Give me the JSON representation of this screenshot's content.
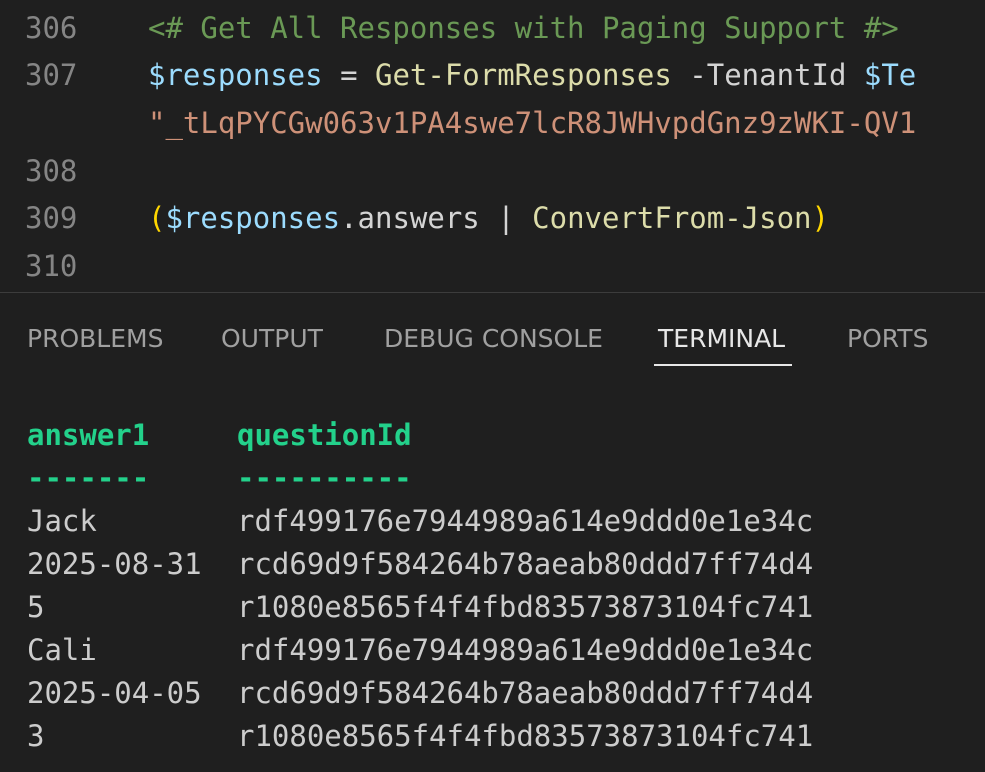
{
  "editor": {
    "lines": [
      {
        "num": "306",
        "tokens": [
          {
            "t": "<# Get All Responses with Paging Support #>",
            "c": "comment"
          }
        ]
      },
      {
        "num": "307",
        "tokens": [
          {
            "t": "$responses",
            "c": "var"
          },
          {
            "t": " = ",
            "c": "op"
          },
          {
            "t": "Get-FormResponses",
            "c": "fn"
          },
          {
            "t": " -TenantId ",
            "c": "param"
          },
          {
            "t": "$Te",
            "c": "var"
          }
        ]
      },
      {
        "num": "",
        "tokens": [
          {
            "t": "\"_tLqPYCGw063v1PA4swe7lcR8JWHvpdGnz9zWKI-QV1",
            "c": "str"
          }
        ]
      },
      {
        "num": "308",
        "tokens": []
      },
      {
        "num": "309",
        "tokens": [
          {
            "t": "(",
            "c": "paren"
          },
          {
            "t": "$responses",
            "c": "var"
          },
          {
            "t": ".answers",
            "c": "plain"
          },
          {
            "t": " | ",
            "c": "op"
          },
          {
            "t": "ConvertFrom-Json",
            "c": "fn"
          },
          {
            "t": ")",
            "c": "paren"
          }
        ]
      },
      {
        "num": "310",
        "tokens": []
      }
    ]
  },
  "panel": {
    "tabs": [
      "PROBLEMS",
      "OUTPUT",
      "DEBUG CONSOLE",
      "TERMINAL",
      "PORTS"
    ],
    "active_tab": "TERMINAL"
  },
  "terminal": {
    "headers": [
      "answer1",
      "questionId"
    ],
    "separators": [
      "-------",
      "----------"
    ],
    "rows": [
      [
        "Jack",
        "rdf499176e7944989a614e9ddd0e1e34c"
      ],
      [
        "2025-08-31",
        "rcd69d9f584264b78aeab80ddd7ff74d4"
      ],
      [
        "5",
        "r1080e8565f4f4fbd83573873104fc741"
      ],
      [
        "Cali",
        "rdf499176e7944989a614e9ddd0e1e34c"
      ],
      [
        "2025-04-05",
        "rcd69d9f584264b78aeab80ddd7ff74d4"
      ],
      [
        "3",
        "r1080e8565f4f4fbd83573873104fc741"
      ]
    ]
  },
  "colors": {
    "background": "#1f1f1f",
    "line_number": "#858585",
    "comment": "#6a9955",
    "variable": "#9cdcfe",
    "function": "#dcdcaa",
    "string": "#ce9178",
    "bracket": "#ffd700",
    "terminal_header": "#23d18b",
    "terminal_text": "#cccccc"
  }
}
